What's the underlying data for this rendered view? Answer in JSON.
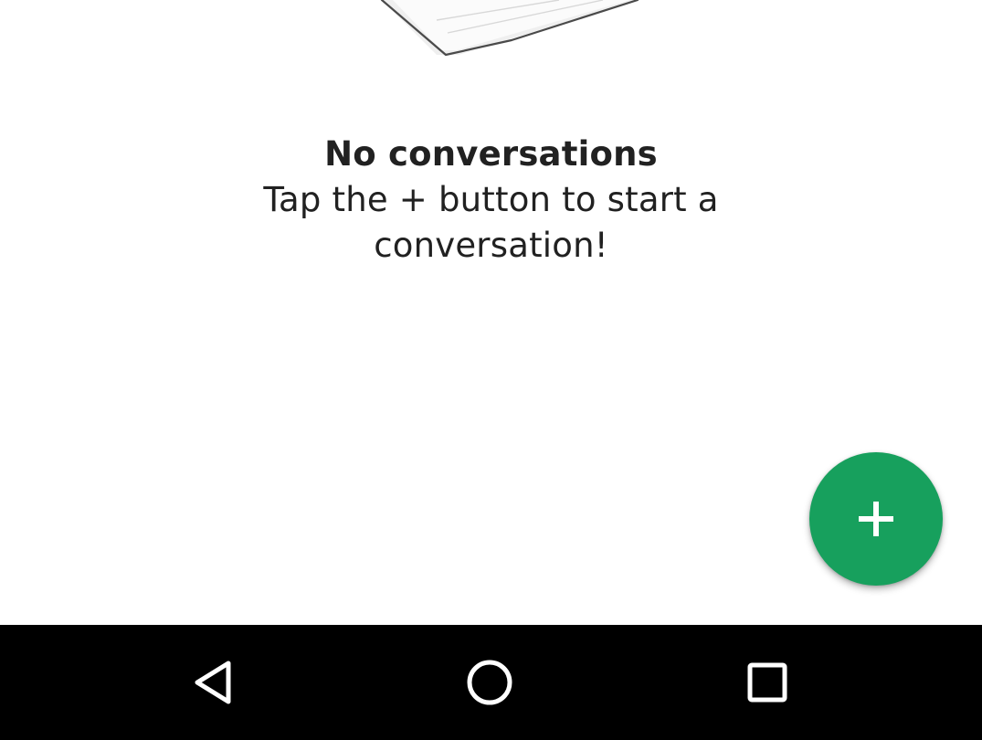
{
  "empty_state": {
    "illustration_icon": "paper-illustration",
    "title": "No conversations",
    "hint": "Tap the + button to start a conversation!"
  },
  "fab": {
    "icon": "plus-icon",
    "color": "#17a05d"
  },
  "navigation_bar": {
    "background": "#000000",
    "buttons": [
      {
        "icon": "back-icon"
      },
      {
        "icon": "home-icon"
      },
      {
        "icon": "recents-icon"
      }
    ]
  }
}
